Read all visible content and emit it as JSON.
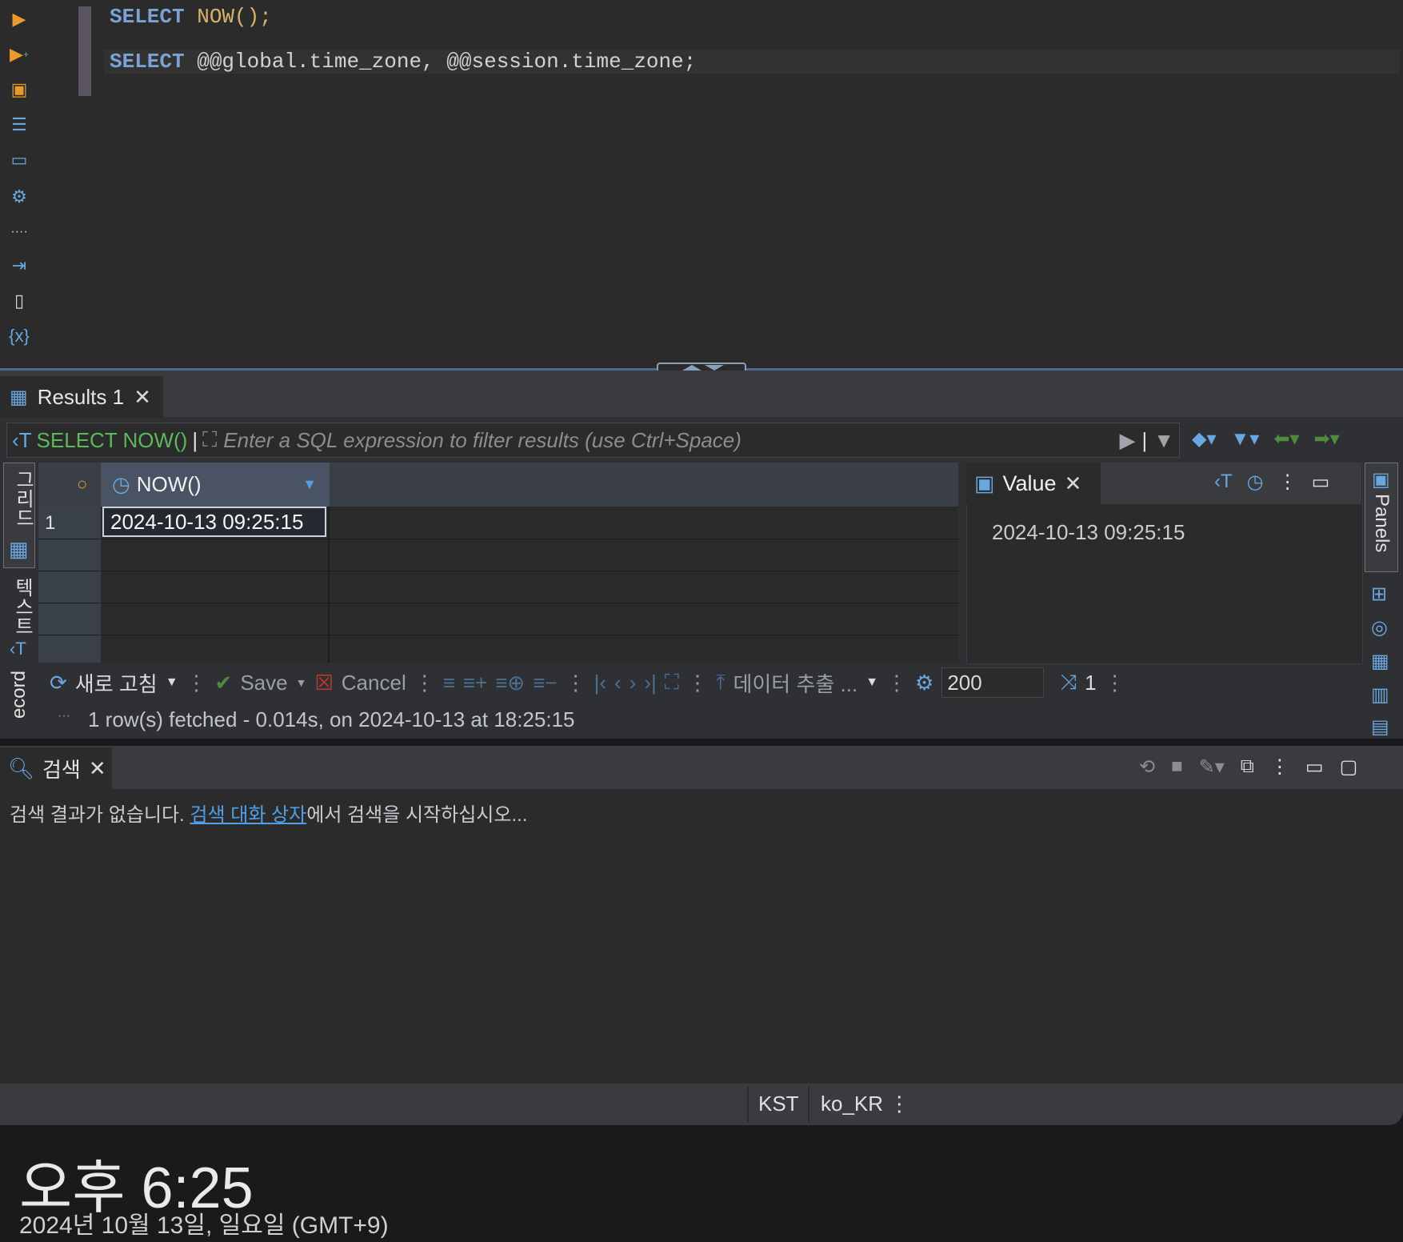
{
  "editor": {
    "lines": [
      {
        "kw": "SELECT",
        "rest": " NOW();"
      },
      {
        "kw": "SELECT",
        "rest": " @@global.time_zone, @@session.time_zone;"
      }
    ]
  },
  "left_toolbar_icons": [
    "execute-icon",
    "execute-new-tab-icon",
    "execute-script-icon",
    "explain-plan-icon",
    "console-icon",
    "settings-icon",
    "more-icon",
    "export-icon",
    "problems-icon",
    "variables-icon"
  ],
  "results": {
    "tab_label": "Results 1",
    "filter_query": "SELECT NOW()",
    "filter_placeholder": "Enter a SQL expression to filter results (use Ctrl+Space)",
    "column_header": "NOW()",
    "row_number": "1",
    "cell_value": "2024-10-13 09:25:15",
    "side_tabs": [
      "그리드",
      "텍스트",
      "ecord"
    ],
    "value_panel": {
      "tab_label": "Value",
      "value": "2024-10-13 09:25:15"
    },
    "right_panel_label": "Panels",
    "toolbar": {
      "refresh_label": "새로 고침",
      "save_label": "Save",
      "cancel_label": "Cancel",
      "export_label": "데이터 추출 ...",
      "fetch_size": "200",
      "row_count": "1"
    },
    "status": "1 row(s) fetched - 0.014s, on 2024-10-13 at 18:25:15"
  },
  "search": {
    "tab_label": "검색",
    "message_prefix": "검색 결과가 없습니다. ",
    "message_link": "검색 대화 상자",
    "message_suffix": "에서 검색을 시작하십시오..."
  },
  "statusbar": {
    "timezone": "KST",
    "locale": "ko_KR"
  },
  "desktop_clock": {
    "time": "오후 6:25",
    "date": "2024년 10월 13일, 일요일 (GMT+9)"
  }
}
